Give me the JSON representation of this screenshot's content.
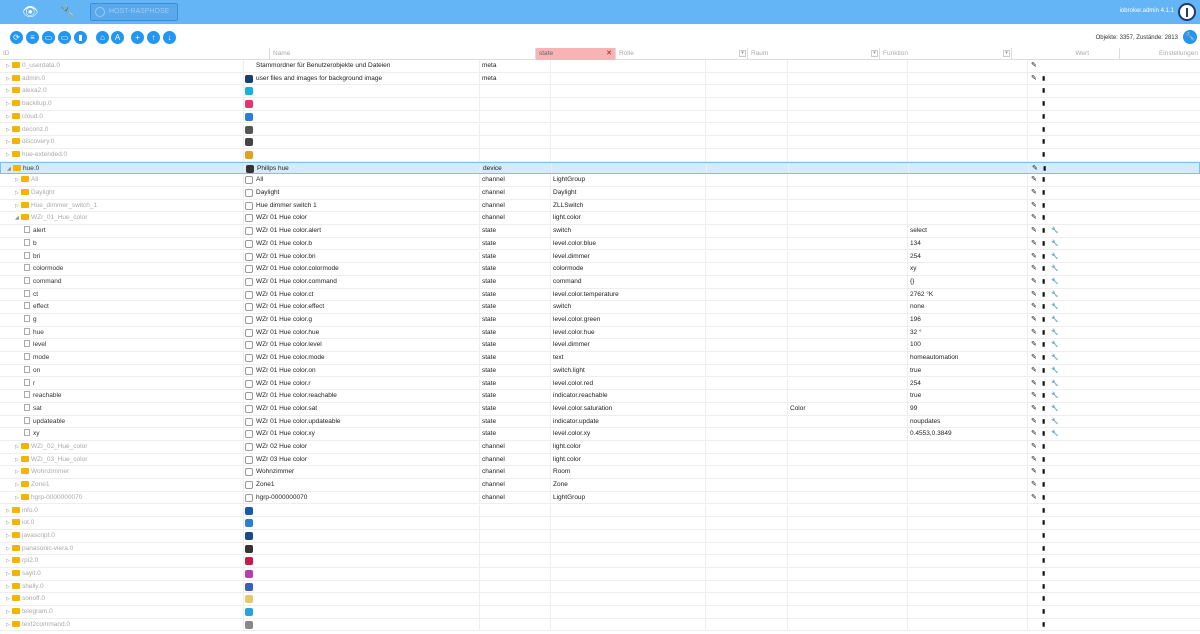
{
  "topbar": {
    "host_label": "HOST-RASPHOSE",
    "user_label": "iobroker.admin 4.1.1"
  },
  "toolbar": {
    "counts": "Objekte: 3357, Zustände: 2813"
  },
  "columns": {
    "id": "ID",
    "name": "Name",
    "type_filter": "state",
    "role": "Rolle",
    "room": "Raum",
    "function": "Funktion",
    "value": "Wert",
    "settings": "Einstellungen"
  },
  "colors": {
    "topbar": "#64b5f6",
    "accent": "#2196f3",
    "folder": "#f4b400",
    "state_filter_bg": "#f8b4b4",
    "selected_row": "#d3ebfa"
  },
  "rows": [
    {
      "id": "0_userdata.0",
      "name": "Stammordner für Benutzerobjekte und Dateien",
      "type": "meta",
      "role": "",
      "room": "",
      "func": "",
      "value": "",
      "icon": "",
      "actions": "pencil"
    },
    {
      "id": "admin.0",
      "name": "user files and images for background image",
      "type": "meta",
      "role": "",
      "room": "",
      "func": "",
      "value": "",
      "icon": "#1f3b70",
      "actions": "pencil-delete"
    },
    {
      "id": "alexa2.0",
      "name": "",
      "type": "",
      "role": "",
      "room": "",
      "func": "",
      "value": "",
      "icon": "#12b5d6",
      "actions": "delete"
    },
    {
      "id": "backitup.0",
      "name": "",
      "type": "",
      "role": "",
      "room": "",
      "func": "",
      "value": "",
      "icon": "#e8336d",
      "actions": "delete"
    },
    {
      "id": "cloud.0",
      "name": "",
      "type": "",
      "role": "",
      "room": "",
      "func": "",
      "value": "",
      "icon": "#2a7fd4",
      "actions": "delete"
    },
    {
      "id": "deconz.0",
      "name": "",
      "type": "",
      "role": "",
      "room": "",
      "func": "",
      "value": "",
      "icon": "#555555",
      "actions": "delete"
    },
    {
      "id": "discovery.0",
      "name": "",
      "type": "",
      "role": "",
      "room": "",
      "func": "",
      "value": "",
      "icon": "#444444",
      "actions": "delete"
    },
    {
      "id": "hue-extended.0",
      "name": "",
      "type": "",
      "role": "",
      "room": "",
      "func": "",
      "value": "",
      "icon": "#e0a020",
      "actions": "delete"
    },
    {
      "id": "hue.0",
      "name": "Philips hue",
      "type": "device",
      "role": "",
      "room": "",
      "func": "",
      "value": "",
      "icon": "#333333",
      "actions": "pencil-delete",
      "selected": true,
      "expanded": true
    },
    {
      "id": "All",
      "name": "All",
      "type": "channel",
      "role": "LightGroup",
      "room": "",
      "func": "",
      "value": "",
      "icon": "file",
      "actions": "pencil-delete",
      "level": 1
    },
    {
      "id": "Daylight",
      "name": "Daylight",
      "type": "channel",
      "role": "Daylight",
      "room": "",
      "func": "",
      "value": "",
      "icon": "file",
      "actions": "pencil-delete",
      "level": 1
    },
    {
      "id": "Hue_dimmer_switch_1",
      "name": "Hue dimmer switch 1",
      "type": "channel",
      "role": "ZLLSwitch",
      "room": "",
      "func": "",
      "value": "",
      "icon": "file",
      "actions": "pencil-delete",
      "level": 1
    },
    {
      "id": "WZr_01_Hue_color",
      "name": "WZr 01 Hue color",
      "type": "channel",
      "role": "light.color",
      "room": "",
      "func": "",
      "value": "",
      "icon": "file",
      "actions": "pencil-delete",
      "level": 1,
      "expanded": true
    },
    {
      "id": "alert",
      "name": "WZr 01 Hue color.alert",
      "type": "state",
      "role": "switch",
      "room": "",
      "func": "",
      "value": "select",
      "icon": "file",
      "actions": "all",
      "level": 2
    },
    {
      "id": "b",
      "name": "WZr 01 Hue color.b",
      "type": "state",
      "role": "level.color.blue",
      "room": "",
      "func": "",
      "value": "134",
      "icon": "file",
      "actions": "all",
      "level": 2
    },
    {
      "id": "bri",
      "name": "WZr 01 Hue color.bri",
      "type": "state",
      "role": "level.dimmer",
      "room": "",
      "func": "",
      "value": "254",
      "icon": "file",
      "actions": "all",
      "level": 2
    },
    {
      "id": "colormode",
      "name": "WZr 01 Hue color.colormode",
      "type": "state",
      "role": "colormode",
      "room": "",
      "func": "",
      "value": "xy",
      "icon": "file",
      "actions": "all",
      "level": 2
    },
    {
      "id": "command",
      "name": "WZr 01 Hue color.command",
      "type": "state",
      "role": "command",
      "room": "",
      "func": "",
      "value": "{}",
      "icon": "file",
      "actions": "all",
      "level": 2
    },
    {
      "id": "ct",
      "name": "WZr 01 Hue color.ct",
      "type": "state",
      "role": "level.color.temperature",
      "room": "",
      "func": "",
      "value": "2762 °K",
      "icon": "file",
      "actions": "all",
      "level": 2
    },
    {
      "id": "effect",
      "name": "WZr 01 Hue color.effect",
      "type": "state",
      "role": "switch",
      "room": "",
      "func": "",
      "value": "none",
      "icon": "file",
      "actions": "all",
      "level": 2
    },
    {
      "id": "g",
      "name": "WZr 01 Hue color.g",
      "type": "state",
      "role": "level.color.green",
      "room": "",
      "func": "",
      "value": "196",
      "icon": "file",
      "actions": "all",
      "level": 2
    },
    {
      "id": "hue",
      "name": "WZr 01 Hue color.hue",
      "type": "state",
      "role": "level.color.hue",
      "room": "",
      "func": "",
      "value": "32 °",
      "icon": "file",
      "actions": "all",
      "level": 2
    },
    {
      "id": "level",
      "name": "WZr 01 Hue color.level",
      "type": "state",
      "role": "level.dimmer",
      "room": "",
      "func": "",
      "value": "100",
      "icon": "file",
      "actions": "all",
      "level": 2
    },
    {
      "id": "mode",
      "name": "WZr 01 Hue color.mode",
      "type": "state",
      "role": "text",
      "room": "",
      "func": "",
      "value": "homeautomation",
      "icon": "file",
      "actions": "all",
      "level": 2
    },
    {
      "id": "on",
      "name": "WZr 01 Hue color.on",
      "type": "state",
      "role": "switch.light",
      "room": "",
      "func": "",
      "value": "true",
      "icon": "file",
      "actions": "all",
      "level": 2
    },
    {
      "id": "r",
      "name": "WZr 01 Hue color.r",
      "type": "state",
      "role": "level.color.red",
      "room": "",
      "func": "",
      "value": "254",
      "icon": "file",
      "actions": "all",
      "level": 2
    },
    {
      "id": "reachable",
      "name": "WZr 01 Hue color.reachable",
      "type": "state",
      "role": "indicator.reachable",
      "room": "",
      "func": "",
      "value": "true",
      "icon": "file",
      "actions": "all",
      "level": 2
    },
    {
      "id": "sat",
      "name": "WZr 01 Hue color.sat",
      "type": "state",
      "role": "level.color.saturation",
      "room": "",
      "func": "Color",
      "value": "99",
      "icon": "file",
      "actions": "all",
      "level": 2
    },
    {
      "id": "updateable",
      "name": "WZr 01 Hue color.updateable",
      "type": "state",
      "role": "indicator.update",
      "room": "",
      "func": "",
      "value": "noupdates",
      "icon": "file",
      "actions": "all",
      "level": 2
    },
    {
      "id": "xy",
      "name": "WZr 01 Hue color.xy",
      "type": "state",
      "role": "level.color.xy",
      "room": "",
      "func": "",
      "value": "0.4553,0.3849",
      "icon": "file",
      "actions": "all",
      "level": 2
    },
    {
      "id": "WZr_02_Hue_color",
      "name": "WZr 02 Hue color",
      "type": "channel",
      "role": "light.color",
      "room": "",
      "func": "",
      "value": "",
      "icon": "file",
      "actions": "pencil-delete",
      "level": 1
    },
    {
      "id": "WZr_03_Hue_color",
      "name": "WZr 03 Hue color",
      "type": "channel",
      "role": "light.color",
      "room": "",
      "func": "",
      "value": "",
      "icon": "file",
      "actions": "pencil-delete",
      "level": 1
    },
    {
      "id": "Wohnzimmer",
      "name": "Wohnzimmer",
      "type": "channel",
      "role": "Room",
      "room": "",
      "func": "",
      "value": "",
      "icon": "file",
      "actions": "pencil-delete",
      "level": 1
    },
    {
      "id": "Zone1",
      "name": "Zone1",
      "type": "channel",
      "role": "Zone",
      "room": "",
      "func": "",
      "value": "",
      "icon": "file",
      "actions": "pencil-delete",
      "level": 1
    },
    {
      "id": "hgrp-0000000070",
      "name": "hgrp-0000000070",
      "type": "channel",
      "role": "LightGroup",
      "room": "",
      "func": "",
      "value": "",
      "icon": "file",
      "actions": "pencil-delete",
      "level": 1
    },
    {
      "id": "info.0",
      "name": "",
      "type": "",
      "role": "",
      "room": "",
      "func": "",
      "value": "",
      "icon": "#1a5aa8",
      "actions": "delete"
    },
    {
      "id": "iot.0",
      "name": "",
      "type": "",
      "role": "",
      "room": "",
      "func": "",
      "value": "",
      "icon": "#2a7fd4",
      "actions": "delete"
    },
    {
      "id": "javascript.0",
      "name": "",
      "type": "",
      "role": "",
      "room": "",
      "func": "",
      "value": "",
      "icon": "#1a4a8a",
      "actions": "delete"
    },
    {
      "id": "panasonic-viera.0",
      "name": "",
      "type": "",
      "role": "",
      "room": "",
      "func": "",
      "value": "",
      "icon": "#333333",
      "actions": "delete"
    },
    {
      "id": "rpi2.0",
      "name": "",
      "type": "",
      "role": "",
      "room": "",
      "func": "",
      "value": "",
      "icon": "#c51a4a",
      "actions": "delete"
    },
    {
      "id": "sayit.0",
      "name": "",
      "type": "",
      "role": "",
      "room": "",
      "func": "",
      "value": "",
      "icon": "#b53fae",
      "actions": "delete"
    },
    {
      "id": "shelly.0",
      "name": "",
      "type": "",
      "role": "",
      "room": "",
      "func": "",
      "value": "",
      "icon": "#3a5fb8",
      "actions": "delete"
    },
    {
      "id": "sonoff.0",
      "name": "",
      "type": "",
      "role": "",
      "room": "",
      "func": "",
      "value": "",
      "icon": "#e6c96a",
      "actions": "delete"
    },
    {
      "id": "telegram.0",
      "name": "",
      "type": "",
      "role": "",
      "room": "",
      "func": "",
      "value": "",
      "icon": "#2aa3dd",
      "actions": "delete"
    },
    {
      "id": "text2command.0",
      "name": "",
      "type": "",
      "role": "",
      "room": "",
      "func": "",
      "value": "",
      "icon": "#888888",
      "actions": "delete"
    }
  ]
}
